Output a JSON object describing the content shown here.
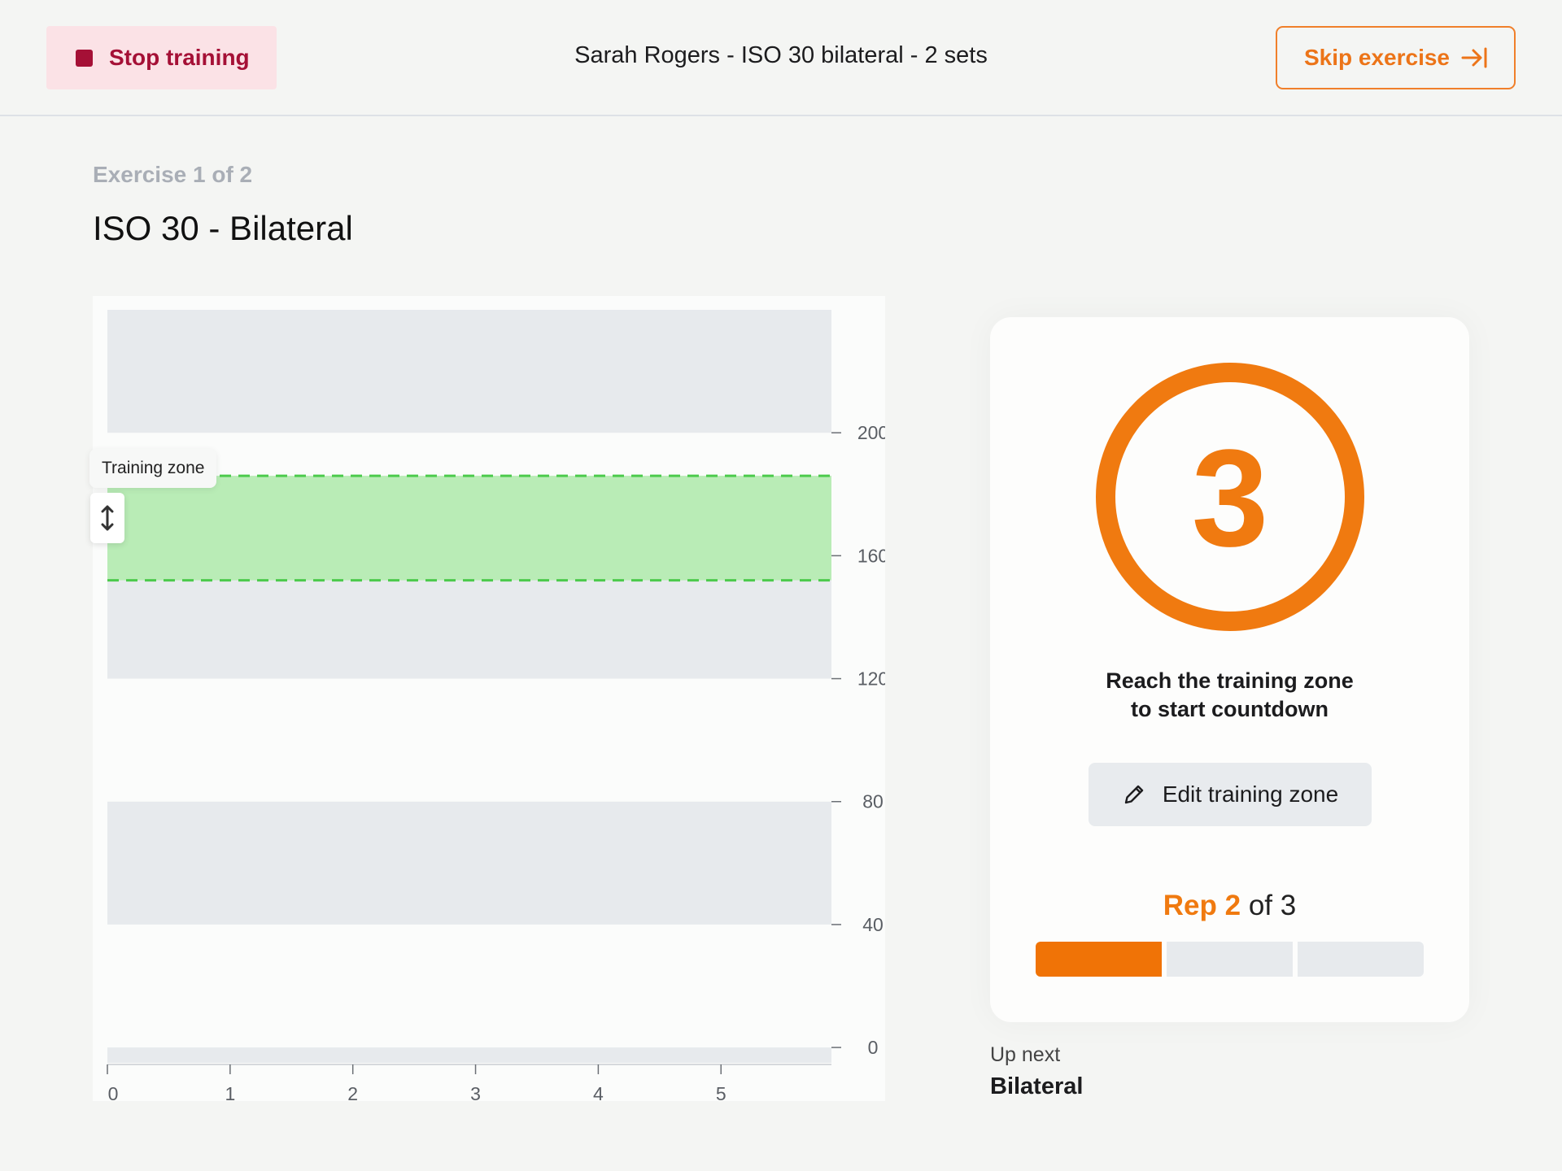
{
  "header": {
    "stop_label": "Stop training",
    "session_title": "Sarah Rogers - ISO 30 bilateral - 2 sets",
    "skip_label": "Skip exercise"
  },
  "exercise": {
    "count_label": "Exercise 1 of 2",
    "title": "ISO 30 - Bilateral"
  },
  "chart_data": {
    "type": "area",
    "title": "",
    "xlabel": "",
    "ylabel": "",
    "xlim": [
      0,
      5.9
    ],
    "ylim": [
      -5,
      240
    ],
    "x_ticks": [
      "0",
      "1",
      "2",
      "3",
      "4",
      "5"
    ],
    "y_ticks": [
      "0",
      "40",
      "80",
      "120",
      "160",
      "200"
    ],
    "band_ranges": [
      [
        200,
        240
      ],
      [
        120,
        160
      ],
      [
        40,
        80
      ],
      [
        -5,
        0
      ]
    ],
    "training_zone": {
      "label": "Training zone",
      "min": 152,
      "max": 186,
      "color": "#b9ecb6",
      "border": "#4cca4c"
    },
    "series": []
  },
  "countdown": {
    "value": "3",
    "hint_line1": "Reach the training zone",
    "hint_line2": "to start countdown",
    "edit_label": "Edit training zone",
    "accent": "#f07a10"
  },
  "rep": {
    "prefix": "Rep",
    "current": "2",
    "suffix": "of 3",
    "completed": 1,
    "total": 3
  },
  "up_next": {
    "label": "Up next",
    "name": "Bilateral"
  },
  "icons": {
    "stop": "stop-square-icon",
    "skip": "arrow-right-to-line-icon",
    "drag": "vertical-resize-icon",
    "edit": "pencil-icon"
  }
}
